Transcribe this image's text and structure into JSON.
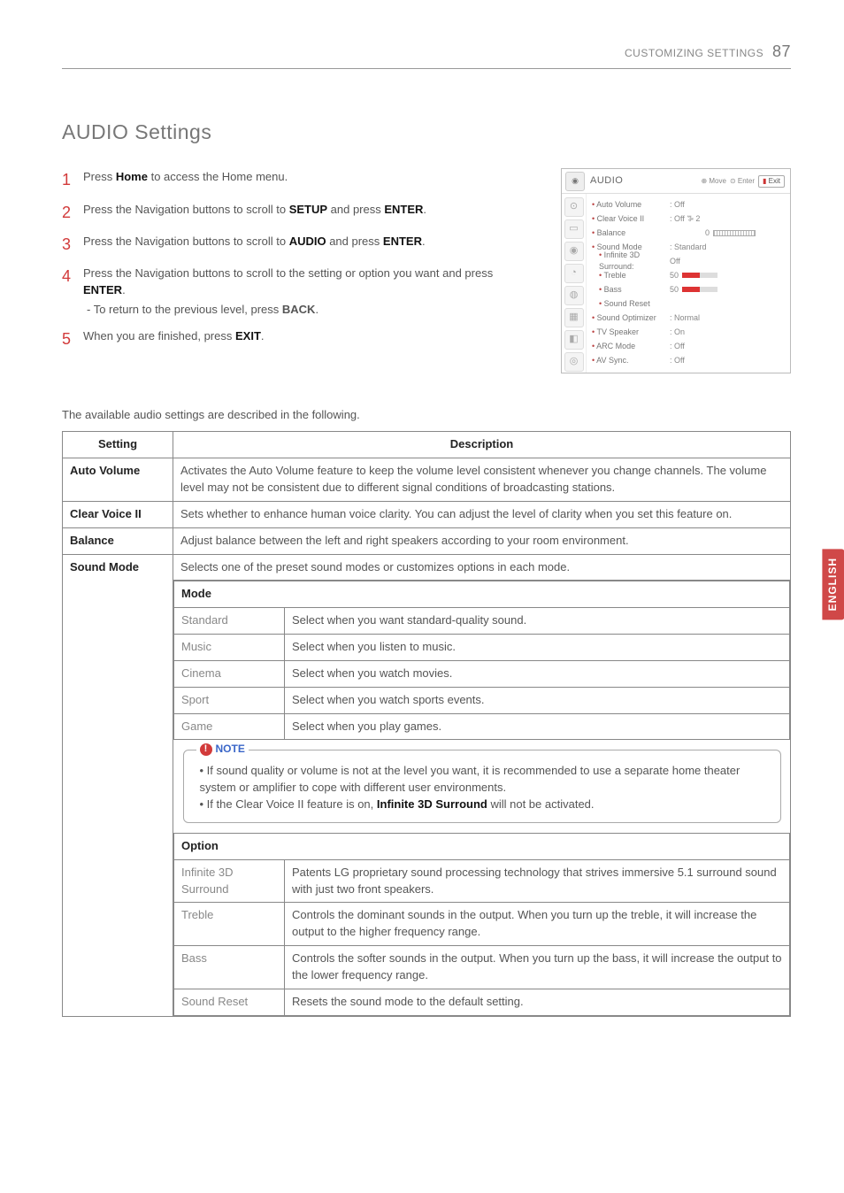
{
  "header": {
    "section": "CUSTOMIZING SETTINGS",
    "page_number": "87"
  },
  "title": "AUDIO Settings",
  "side_tab": "ENGLISH",
  "steps": [
    {
      "n": "1",
      "pre": "Press ",
      "b1": "Home",
      "post": " to access the Home menu."
    },
    {
      "n": "2",
      "pre": "Press the Navigation buttons to scroll to ",
      "b1": "SETUP",
      "mid": " and press ",
      "b2": "ENTER",
      "post": "."
    },
    {
      "n": "3",
      "pre": "Press the Navigation buttons to scroll to ",
      "b1": "AUDIO",
      "mid": " and press ",
      "b2": "ENTER",
      "post": "."
    },
    {
      "n": "4",
      "pre": "Press the Navigation buttons to scroll to the setting or option you want and press ",
      "b1": "ENTER",
      "post": "."
    },
    {
      "n": "5",
      "pre": "When you are finished, press ",
      "b1": "EXIT",
      "post": "."
    }
  ],
  "substep_4": {
    "pre": "- To return to the previous level, press ",
    "b": "BACK",
    "post": "."
  },
  "osd": {
    "title": "AUDIO",
    "hint_move": "Move",
    "hint_enter": "Enter",
    "exit": "Exit",
    "rows": {
      "auto_volume": {
        "label": "Auto Volume",
        "value": ": Off"
      },
      "clear_voice": {
        "label": "Clear Voice II",
        "value": ": Off ꕅ 2"
      },
      "balance": {
        "label": "Balance",
        "value": "0"
      },
      "sound_mode": {
        "label": "Sound Mode",
        "value": ": Standard"
      },
      "inf3d": {
        "label": "Infinite 3D Surround:",
        "value": "Off"
      },
      "treble": {
        "label": "Treble",
        "value": "50"
      },
      "bass": {
        "label": "Bass",
        "value": "50"
      },
      "sreset": {
        "label": "Sound Reset",
        "value": ""
      },
      "sopt": {
        "label": "Sound Optimizer",
        "value": ": Normal"
      },
      "tvspk": {
        "label": "TV Speaker",
        "value": ": On"
      },
      "arc": {
        "label": "ARC Mode",
        "value": ": Off"
      },
      "avsync": {
        "label": "AV Sync.",
        "value": ": Off"
      }
    },
    "tab_icons": [
      "⊙",
      "▭",
      "◉",
      "◔",
      "◍",
      "▦",
      "◧",
      "◎"
    ]
  },
  "intro": "The available audio settings are described in the following.",
  "table": {
    "head": {
      "setting": "Setting",
      "desc": "Description"
    },
    "rows": {
      "auto_volume": {
        "name": "Auto Volume",
        "desc": "Activates the Auto Volume feature to keep the volume level consistent whenever you change channels. The volume level may not be consistent due to different signal conditions of broadcasting stations."
      },
      "clear_voice": {
        "name": "Clear Voice II",
        "desc": "Sets whether to enhance human voice clarity. You can adjust the level of clarity when you set this feature on."
      },
      "balance": {
        "name": "Balance",
        "desc": "Adjust balance between the left and right speakers according to your room environment."
      },
      "sound_mode": {
        "name": "Sound Mode",
        "desc": "Selects one of the preset sound modes or customizes options in each mode."
      }
    },
    "mode_header": "Mode",
    "modes": [
      {
        "name": "Standard",
        "desc": "Select when you want standard-quality sound."
      },
      {
        "name": "Music",
        "desc": "Select when you listen to music."
      },
      {
        "name": "Cinema",
        "desc": "Select when you watch movies."
      },
      {
        "name": "Sport",
        "desc": "Select when you watch sports events."
      },
      {
        "name": "Game",
        "desc": "Select when you play games."
      }
    ],
    "note": {
      "label": "NOTE",
      "item1": "If sound quality or volume is not at the level you want, it is recommended to use a separate home theater system or amplifier to cope with different user environments.",
      "item2_pre": "If the Clear Voice II feature is on, ",
      "item2_b": "Infinite 3D Surround",
      "item2_post": " will not be activated."
    },
    "option_header": "Option",
    "options": [
      {
        "name": "Infinite 3D Surround",
        "desc": "Patents LG proprietary sound processing technology that strives immersive 5.1 surround sound with just two front speakers."
      },
      {
        "name": "Treble",
        "desc": "Controls the dominant sounds in the output. When you turn up the treble, it will increase the output to the higher frequency range."
      },
      {
        "name": "Bass",
        "desc": "Controls the softer sounds in the output. When you turn up the bass, it will increase the output to the lower frequency range."
      },
      {
        "name": "Sound Reset",
        "desc": "Resets the sound mode to the default setting."
      }
    ]
  }
}
